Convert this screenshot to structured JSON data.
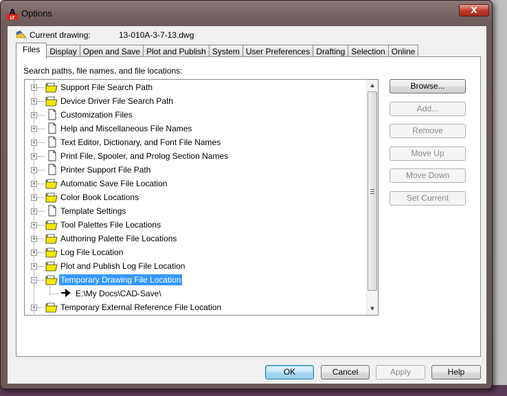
{
  "window": {
    "title": "Options",
    "close_label": "X"
  },
  "current_drawing": {
    "label": "Current drawing:",
    "value": "13-010A-3-7-13.dwg"
  },
  "tabs": [
    {
      "label": "Files",
      "active": true
    },
    {
      "label": "Display"
    },
    {
      "label": "Open and Save"
    },
    {
      "label": "Plot and Publish"
    },
    {
      "label": "System"
    },
    {
      "label": "User Preferences"
    },
    {
      "label": "Drafting"
    },
    {
      "label": "Selection"
    },
    {
      "label": "Online"
    }
  ],
  "files": {
    "section_label": "Search paths, file names, and file locations:",
    "tree": [
      {
        "label": "Support File Search Path",
        "icon": "folder",
        "expanded": false
      },
      {
        "label": "Device Driver File Search Path",
        "icon": "folder",
        "expanded": false
      },
      {
        "label": "Customization Files",
        "icon": "document",
        "expanded": false
      },
      {
        "label": "Help and Miscellaneous File Names",
        "icon": "document",
        "expanded": false
      },
      {
        "label": "Text Editor, Dictionary, and Font File Names",
        "icon": "document",
        "expanded": false
      },
      {
        "label": "Print File, Spooler, and Prolog Section Names",
        "icon": "document",
        "expanded": false
      },
      {
        "label": "Printer Support File Path",
        "icon": "document",
        "expanded": false
      },
      {
        "label": "Automatic Save File Location",
        "icon": "folder",
        "expanded": false
      },
      {
        "label": "Color Book Locations",
        "icon": "folder",
        "expanded": false
      },
      {
        "label": "Template Settings",
        "icon": "document",
        "expanded": false
      },
      {
        "label": "Tool Palettes File Locations",
        "icon": "folder",
        "expanded": false
      },
      {
        "label": "Authoring Palette File Locations",
        "icon": "folder",
        "expanded": false
      },
      {
        "label": "Log File Location",
        "icon": "folder",
        "expanded": false
      },
      {
        "label": "Plot and Publish Log File Location",
        "icon": "folder",
        "expanded": false
      },
      {
        "label": "Temporary Drawing File Location",
        "icon": "folder",
        "expanded": true,
        "selected": true
      },
      {
        "label": "E:\\My Docs\\CAD-Save\\",
        "icon": "arrow",
        "child": true
      },
      {
        "label": "Temporary External Reference File Location",
        "icon": "folder",
        "expanded": false
      }
    ],
    "buttons": {
      "browse": "Browse...",
      "add": "Add...",
      "remove": "Remove",
      "move_up": "Move Up",
      "move_down": "Move Down",
      "set_current": "Set Current"
    }
  },
  "footer": {
    "ok": "OK",
    "cancel": "Cancel",
    "apply": "Apply",
    "help": "Help"
  },
  "colors": {
    "selection": "#3399ff",
    "folder": "#f5e600",
    "close_button": "#c0392b"
  }
}
